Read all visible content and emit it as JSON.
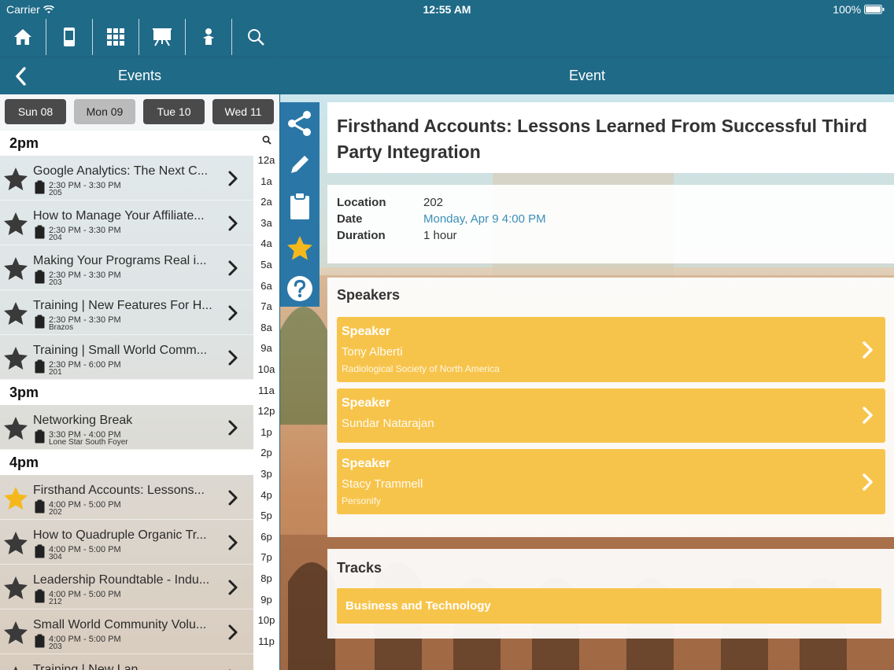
{
  "status_bar": {
    "carrier": "Carrier",
    "time": "12:55 AM",
    "battery": "100%"
  },
  "toolbar": {
    "icons": [
      "home-icon",
      "device-icon",
      "grid-icon",
      "presentation-icon",
      "sponsor-icon",
      "search-icon"
    ]
  },
  "left_nav": {
    "title": "Events"
  },
  "right_nav": {
    "title": "Event"
  },
  "day_tabs": [
    {
      "label": "Sun 08",
      "selected": false
    },
    {
      "label": "Mon 09",
      "selected": true
    },
    {
      "label": "Tue 10",
      "selected": false
    },
    {
      "label": "Wed 11",
      "selected": false
    }
  ],
  "hours": [
    "2pm",
    "3pm",
    "4pm"
  ],
  "events": [
    {
      "title": "Google Analytics: The Next C...",
      "time": "2:30 PM - 3:30 PM",
      "room": "205",
      "starred": false
    },
    {
      "title": "How to Manage Your Affiliate...",
      "time": "2:30 PM - 3:30 PM",
      "room": "204",
      "starred": false
    },
    {
      "title": "Making Your Programs Real i...",
      "time": "2:30 PM - 3:30 PM",
      "room": "203",
      "starred": false
    },
    {
      "title": "Training | New Features For H...",
      "time": "2:30 PM - 3:30 PM",
      "room": "Brazos",
      "starred": false
    },
    {
      "title": "Training | Small World Comm...",
      "time": "2:30 PM - 6:00 PM",
      "room": "201",
      "starred": false
    },
    {
      "title": "Networking Break",
      "time": "3:30 PM - 4:00 PM",
      "room": "Lone Star South Foyer",
      "starred": false
    },
    {
      "title": "Firsthand Accounts: Lessons...",
      "time": "4:00 PM - 5:00 PM",
      "room": "202",
      "starred": true
    },
    {
      "title": "How to Quadruple Organic Tr...",
      "time": "4:00 PM - 5:00 PM",
      "room": "304",
      "starred": false
    },
    {
      "title": "Leadership Roundtable - Indu...",
      "time": "4:00 PM - 5:00 PM",
      "room": "212",
      "starred": false
    },
    {
      "title": "Small World Community Volu...",
      "time": "4:00 PM - 5:00 PM",
      "room": "203",
      "starred": false
    },
    {
      "title": "Training | New Lan...",
      "time": "",
      "room": "",
      "starred": false
    }
  ],
  "index": [
    "12a",
    "1a",
    "2a",
    "3a",
    "4a",
    "5a",
    "6a",
    "7a",
    "8a",
    "9a",
    "10a",
    "11a",
    "12p",
    "1p",
    "2p",
    "3p",
    "4p",
    "5p",
    "6p",
    "7p",
    "8p",
    "9p",
    "10p",
    "11p"
  ],
  "event_detail": {
    "title": "Firsthand Accounts: Lessons Learned From Successful Third Party Integration",
    "location_label": "Location",
    "location": "202",
    "date_label": "Date",
    "date": "Monday, Apr 9 4:00 PM",
    "duration_label": "Duration",
    "duration": "1 hour",
    "speakers_title": "Speakers",
    "speakers": [
      {
        "heading": "Speaker",
        "name": "Tony Alberti",
        "org": "Radiological Society of North America"
      },
      {
        "heading": "Speaker",
        "name": "Sundar Natarajan",
        "org": ""
      },
      {
        "heading": "Speaker",
        "name": "Stacy Trammell",
        "org": "Personify"
      }
    ],
    "tracks_title": "Tracks",
    "tracks": [
      "Business and Technology"
    ]
  },
  "action_bar": [
    "share-icon",
    "pencil-icon",
    "clipboard-icon",
    "star-icon",
    "help-icon"
  ],
  "colors": {
    "nav": "#1f6a87",
    "action_bar": "#2a77a7",
    "speaker_card": "#f7c44b",
    "star_active": "#f5b81c",
    "link": "#3b8fb8"
  }
}
